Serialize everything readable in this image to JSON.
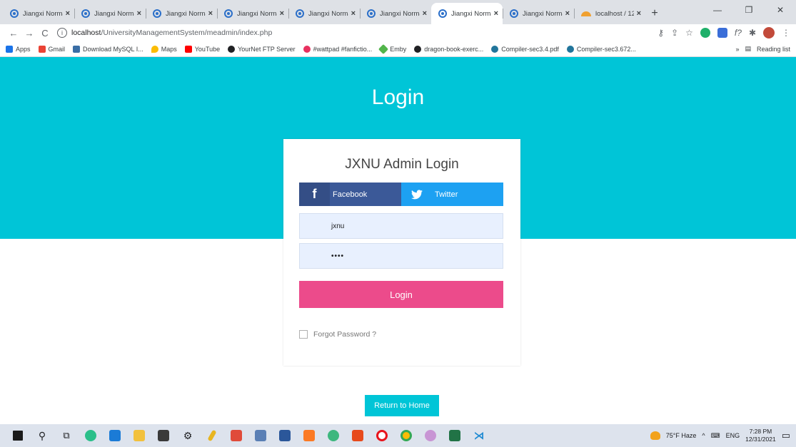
{
  "browser": {
    "tabs": [
      {
        "label": "Jiangxi Norma",
        "active": false,
        "icon": "site-favicon"
      },
      {
        "label": "Jiangxi Norma",
        "active": false,
        "icon": "site-favicon"
      },
      {
        "label": "Jiangxi Norma",
        "active": false,
        "icon": "site-favicon"
      },
      {
        "label": "Jiangxi Norma",
        "active": false,
        "icon": "site-favicon"
      },
      {
        "label": "Jiangxi Norma",
        "active": false,
        "icon": "site-favicon"
      },
      {
        "label": "Jiangxi Norma",
        "active": false,
        "icon": "site-favicon"
      },
      {
        "label": "Jiangxi Norma",
        "active": true,
        "icon": "site-favicon"
      },
      {
        "label": "Jiangxi Norma",
        "active": false,
        "icon": "site-favicon"
      },
      {
        "label": "localhost / 12",
        "active": false,
        "icon": "phpmyadmin-favicon"
      }
    ],
    "new_tab": "+",
    "close_glyph": "×",
    "url_host": "localhost",
    "url_path": "/UniversityManagementSystem/meadmin/index.php",
    "bookmarks": [
      {
        "label": "Apps",
        "color": "#1a73e8"
      },
      {
        "label": "Gmail",
        "color": "#ea4335"
      },
      {
        "label": "Download MySQL I...",
        "color": "#3a6ea5"
      },
      {
        "label": "Maps",
        "color": "#fbbc04"
      },
      {
        "label": "YouTube",
        "color": "#ff0000"
      },
      {
        "label": "YourNet FTP Server",
        "color": "#202124"
      },
      {
        "label": "#wattpad #fanfictio...",
        "color": "#e8315f"
      },
      {
        "label": "Emby",
        "color": "#52b54b"
      },
      {
        "label": "dragon-book-exerc...",
        "color": "#202124"
      },
      {
        "label": "Compiler-sec3.4.pdf",
        "color": "#21759b"
      },
      {
        "label": "Compiler-sec3.672...",
        "color": "#21759b"
      }
    ],
    "bookmarks_more": "»",
    "reading_list": "Reading list"
  },
  "page": {
    "hero_title": "Login",
    "card_title": "JXNU Admin Login",
    "facebook_label": "Facebook",
    "twitter_label": "Twitter",
    "username_value": "jxnu",
    "password_value": "••••",
    "login_button": "Login",
    "forgot_password": "Forgot Password ?",
    "return_home": "Return to Home"
  },
  "taskbar": {
    "weather": "75°F Haze",
    "language": "ENG",
    "time": "7:28 PM",
    "date": "12/31/2021"
  },
  "colors": {
    "hero": "#00c5d7",
    "login_button": "#ec4b8b",
    "facebook": "#3b5998",
    "twitter": "#1da1f2"
  }
}
